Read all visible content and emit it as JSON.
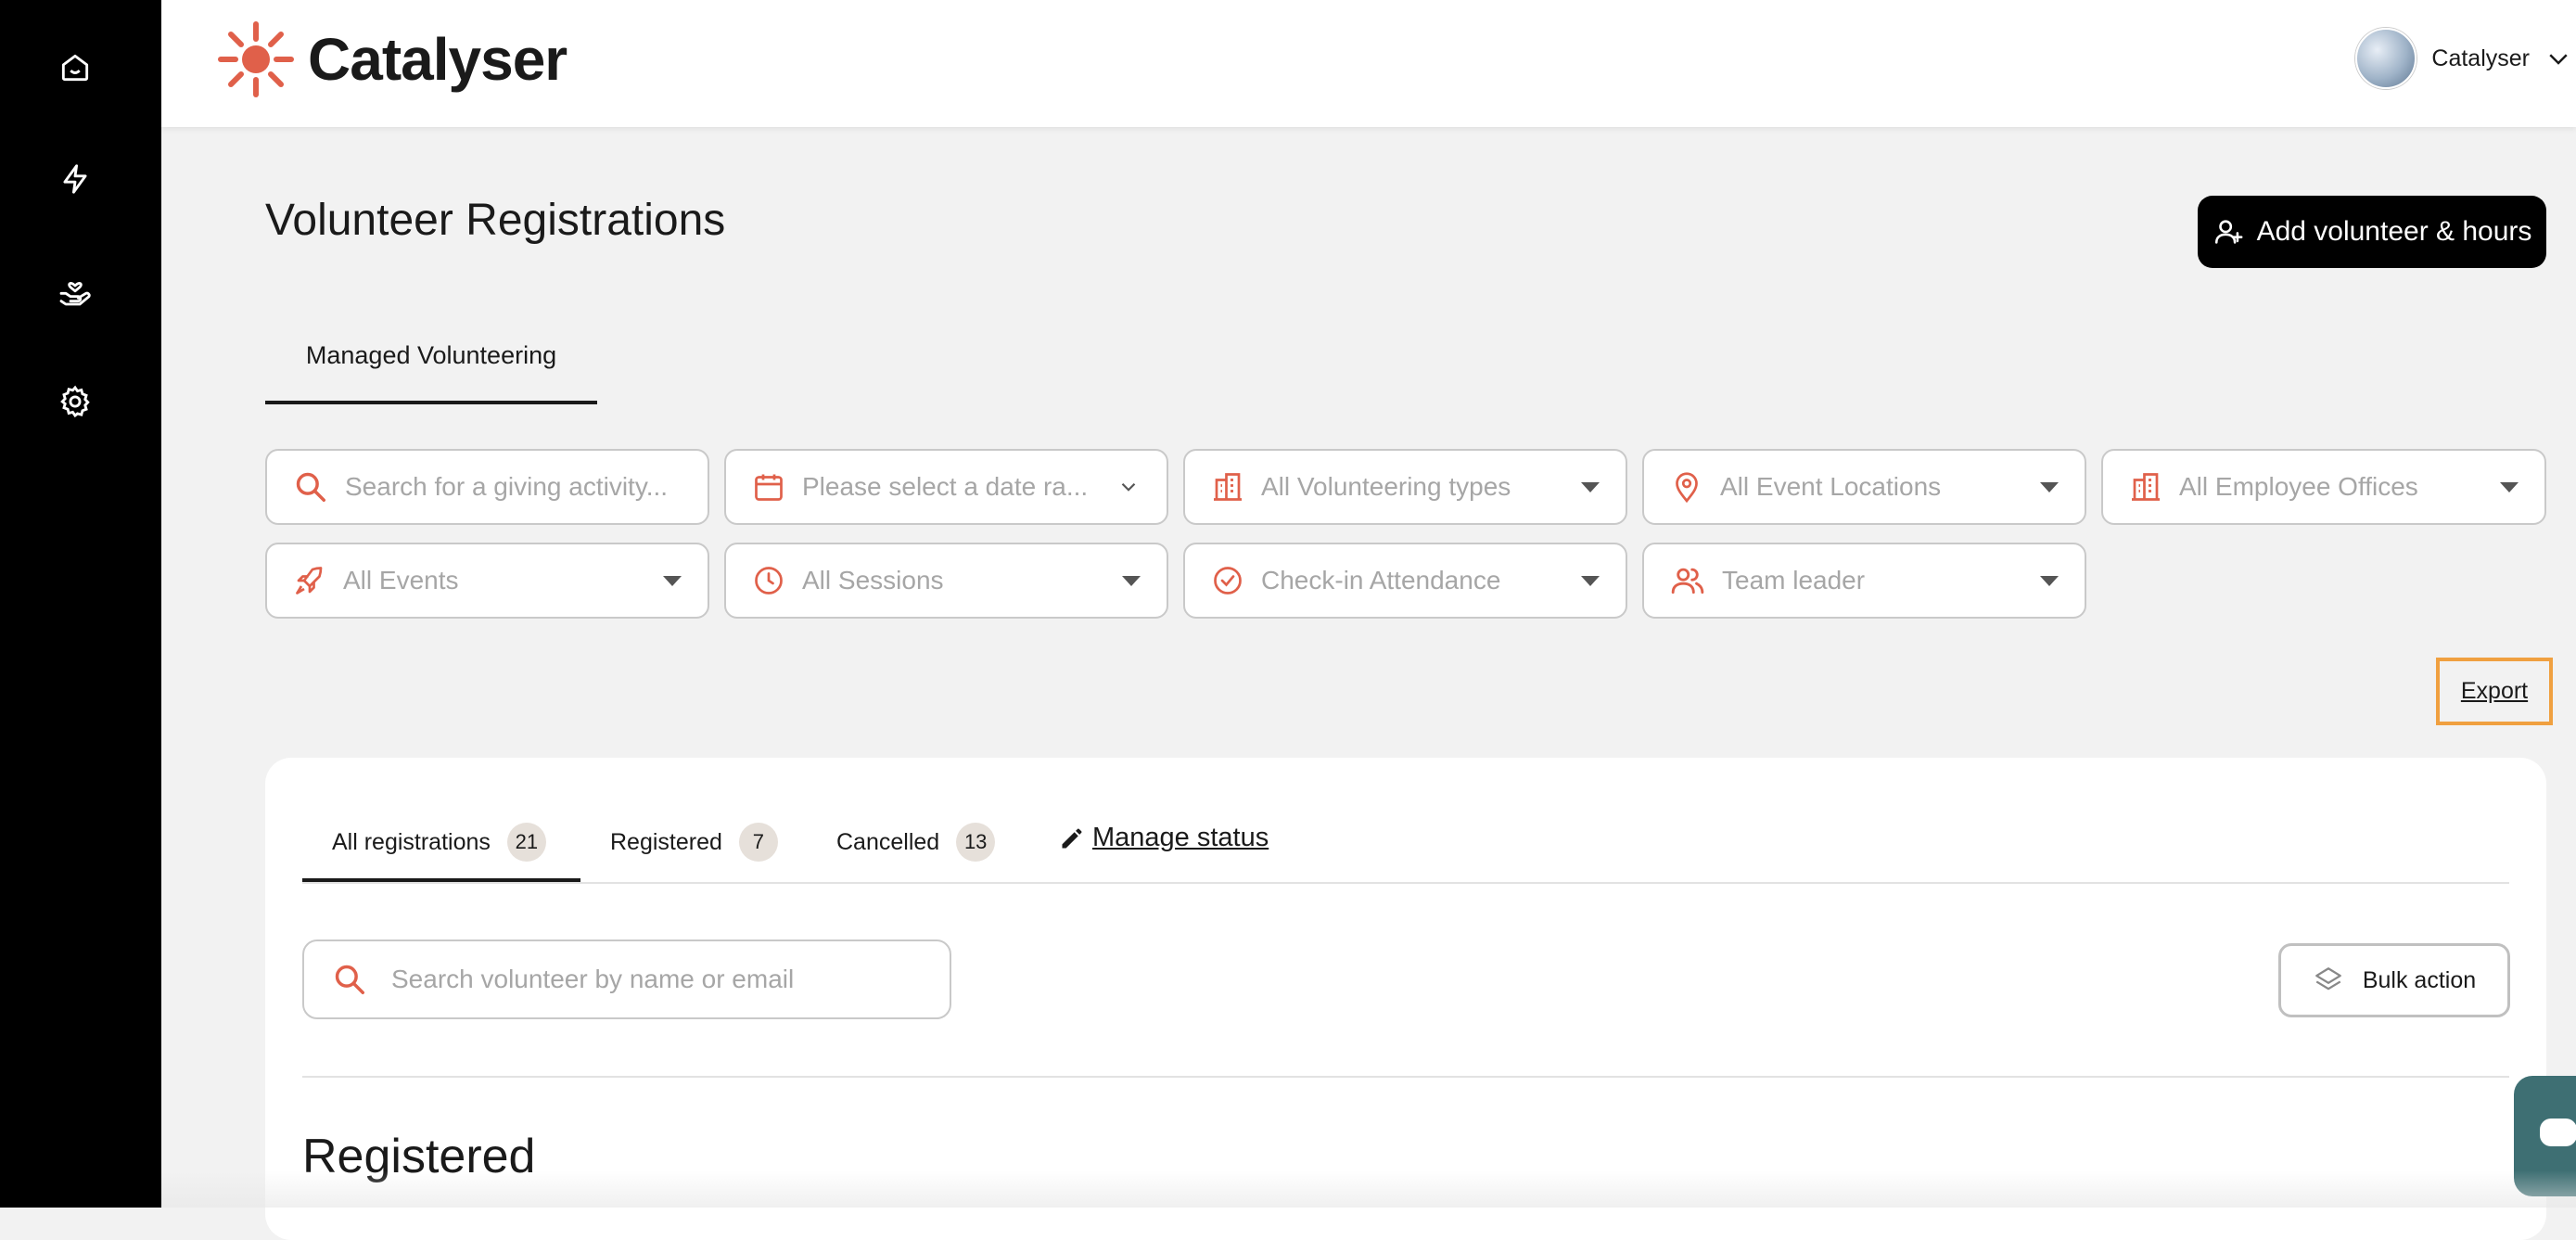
{
  "app": {
    "logo_text": "Catalyser"
  },
  "user": {
    "name": "Catalyser"
  },
  "sidebar": {
    "items": [
      "home-icon",
      "lightning-icon",
      "hand-heart-icon",
      "gear-icon"
    ]
  },
  "page": {
    "title": "Volunteer Registrations",
    "add_button": "Add volunteer & hours"
  },
  "tabs": {
    "main": "Managed Volunteering"
  },
  "filters": {
    "search_placeholder": "Search for a giving activity...",
    "date_placeholder": "Please select a date ra...",
    "volunteering_types": "All Volunteering types",
    "event_locations": "All Event Locations",
    "employee_offices": "All Employee Offices",
    "events": "All Events",
    "sessions": "All Sessions",
    "checkin": "Check-in Attendance",
    "team_leader": "Team leader"
  },
  "export_label": "Export",
  "registration_tabs": [
    {
      "label": "All registrations",
      "count": "21"
    },
    {
      "label": "Registered",
      "count": "7"
    },
    {
      "label": "Cancelled",
      "count": "13"
    }
  ],
  "manage_status": "Manage status",
  "volunteer_search_placeholder": "Search volunteer by name or email",
  "bulk_action": "Bulk action",
  "section_title": "Registered",
  "colors": {
    "accent": "#e0604a",
    "dark": "#000000",
    "highlight": "#f0a040"
  }
}
